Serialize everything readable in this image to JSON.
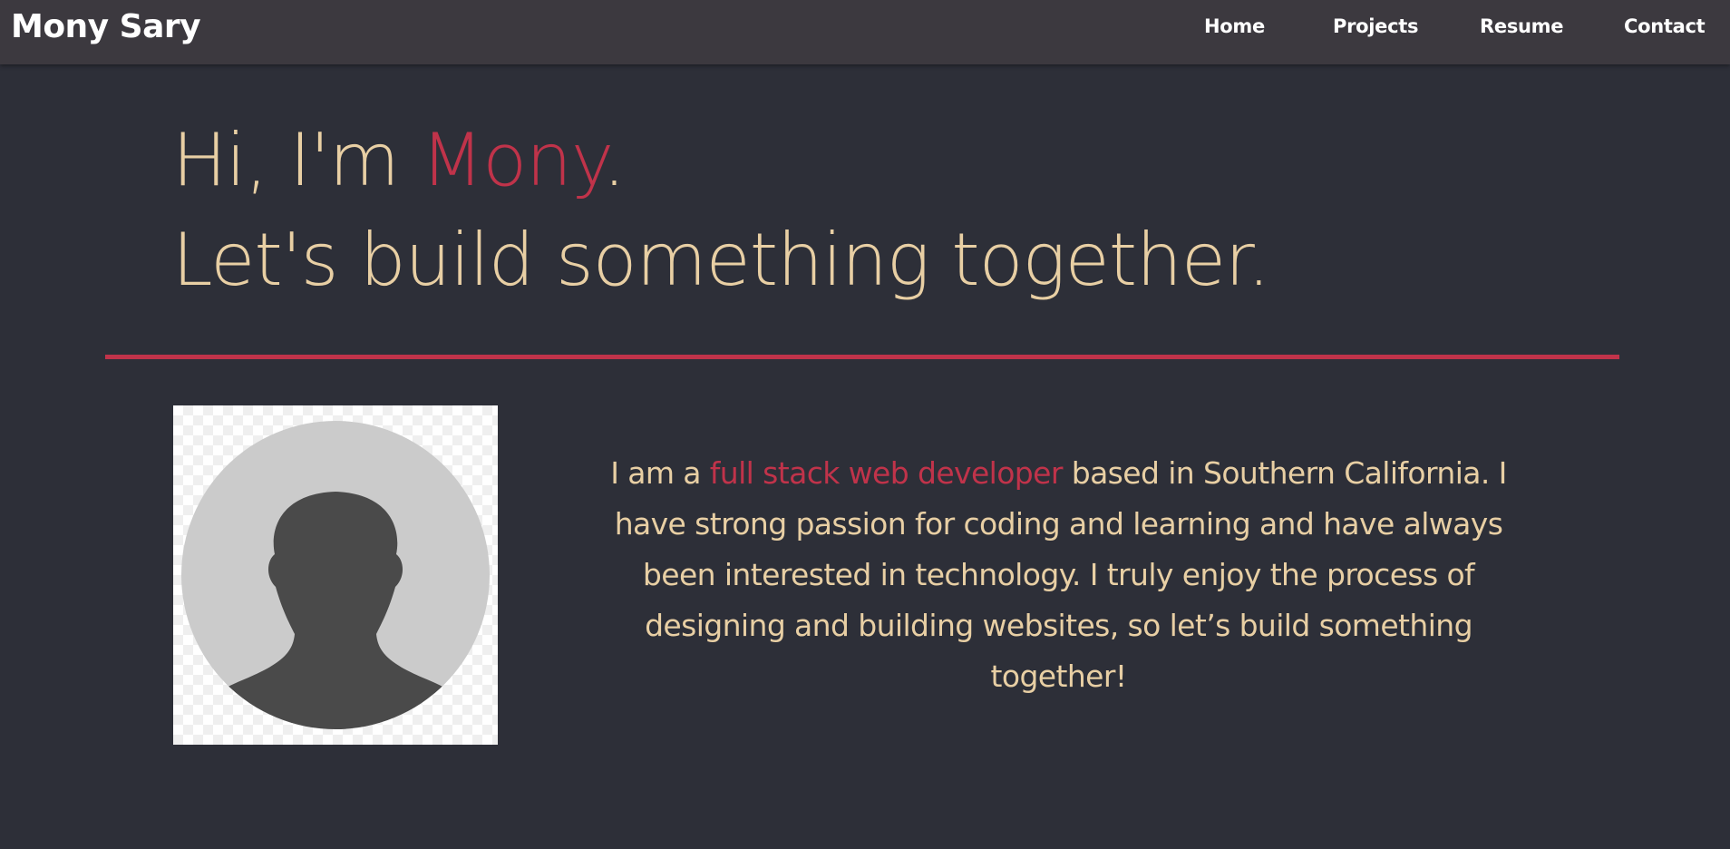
{
  "nav": {
    "brand": "Mony Sary",
    "links": [
      {
        "label": "Home"
      },
      {
        "label": "Projects"
      },
      {
        "label": "Resume"
      },
      {
        "label": "Contact"
      }
    ]
  },
  "hero": {
    "greeting_prefix": "Hi, I'm ",
    "name": "Mony",
    "greeting_suffix": ".",
    "tagline": "Let's build something together."
  },
  "about": {
    "avatar_icon": "person-silhouette-icon",
    "bio_prefix": "I am a ",
    "bio_highlight": "full stack web developer",
    "bio_suffix": " based in Southern California. I have strong passion for coding and learning and have always been interested in technology. I truly enjoy the process of designing and building websites, so let’s build something together!"
  },
  "colors": {
    "background": "#2d2f38",
    "navbar": "#3c393f",
    "accent": "#c0334a",
    "text": "#e8cfa4"
  }
}
